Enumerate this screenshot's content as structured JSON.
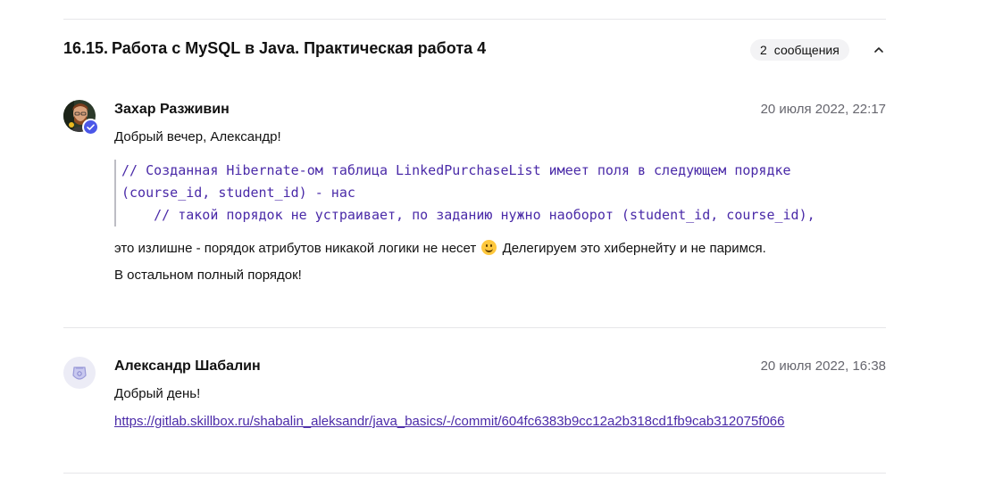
{
  "section": {
    "number": "16.15.",
    "title": "Работа с MySQL в Java. Практическая работа 4",
    "message_count": "2",
    "message_label": "сообщения",
    "collapse_icon": "chevron-up-icon"
  },
  "comments": [
    {
      "author": "Захар Разживин",
      "date": "20 июля 2022, 22:17",
      "greeting": "Добрый вечер, Александр!",
      "code_lines": [
        "// Созданная Hibernate-ом таблица LinkedPurchaseList имеет поля в следующем порядке",
        "(course_id, student_id) - нас",
        "    // такой порядок не устраивает, по заданию нужно наоборот (student_id, course_id),"
      ],
      "text_before_emoji": "это излишне - порядок атрибутов никакой логики не несет",
      "text_after_emoji": "Делегируем это хибернейту и не паримся.",
      "closing": "В остальном полный порядок!",
      "avatar_icon": "user-photo-avatar",
      "badge_icon": "verified-check-icon"
    },
    {
      "author": "Александр Шабалин",
      "date": "20 июля 2022, 16:38",
      "greeting": "Добрый день!",
      "link": "https://gitlab.skillbox.ru/shabalin_aleksandr/java_basics/-/commit/604fc6383b9cc12a2b318cd1fb9cab312075f066",
      "avatar_icon": "default-avatar-icon"
    }
  ],
  "colors": {
    "accent": "#4a2aa8",
    "badge_bg": "#f3f3f5",
    "divider": "#e6e6e9",
    "date_text": "#66666e"
  }
}
